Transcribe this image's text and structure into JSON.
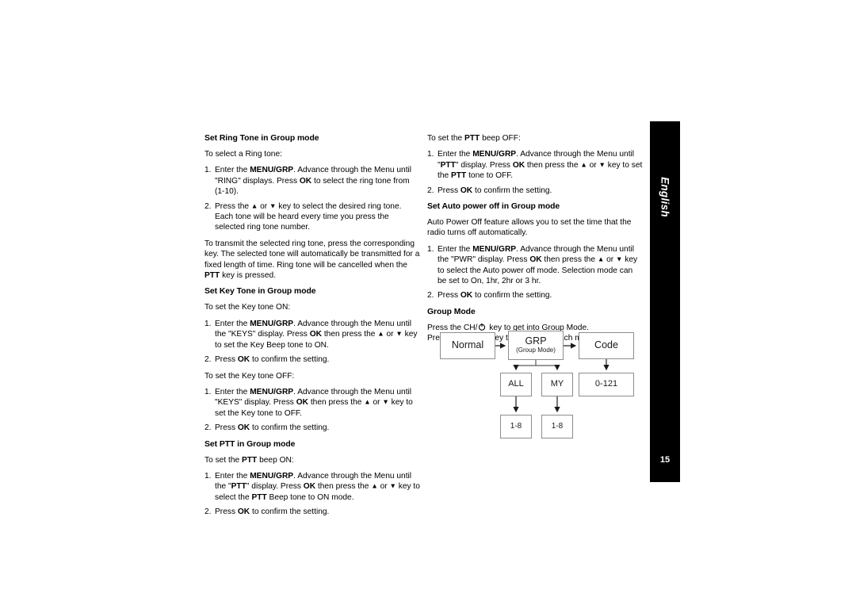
{
  "page": {
    "language_tab": "English",
    "page_number": "15"
  },
  "left_column": {
    "sections": [
      {
        "heading": "Set Ring Tone in Group mode",
        "intro": "To select a Ring tone:",
        "steps": [
          "1. Enter the MENU/GRP. Advance through the Menu until \"RING\" displays. Press OK to select the ring tone from (1-10).",
          "2. Press the ▲ or ▼ key to select the desired ring tone. Each tone will be heard every time you press the selected ring tone number."
        ],
        "outro": "To transmit the selected ring tone, press the corresponding key. The selected tone will automatically be transmitted for a fixed length of time. Ring tone will be cancelled when the PTT key is pressed."
      },
      {
        "heading": "Set Key Tone in Group mode",
        "intro_on": "To set the Key tone ON:",
        "steps_on": [
          "1. Enter the MENU/GRP. Advance through the Menu until the \"KEYS\" display. Press OK then press the ▲ or ▼ key to set the Key Beep tone to ON.",
          "2. Press OK to confirm the setting."
        ],
        "intro_off": "To set the Key tone OFF:",
        "steps_off": [
          "1. Enter the MENU/GRP. Advance through the Menu until \"KEYS\" display. Press OK then press the ▲ or ▼ key to set the Key tone to OFF.",
          "2. Press OK to confirm the setting."
        ]
      },
      {
        "heading": "Set PTT in Group mode",
        "intro": "To set the PTT beep ON:",
        "steps": [
          "1. Enter the MENU/GRP. Advance through the Menu until the \"PTT\" display. Press OK then press the ▲ or ▼ key to select the PTT Beep tone to ON mode.",
          "2. Press OK to confirm the setting."
        ]
      }
    ]
  },
  "right_column": {
    "ptt_off": {
      "intro": "To set the PTT beep OFF:",
      "steps": [
        "1. Enter the MENU/GRP. Advance through the Menu until \"PTT\" display. Press OK then press the ▲ or ▼ key to set the PTT tone to OFF.",
        "2. Press OK to confirm the setting."
      ]
    },
    "auto_power": {
      "heading": "Set Auto power off in Group mode",
      "intro": "Auto Power Off feature allows you to set the time that the radio turns off automatically.",
      "steps": [
        "1. Enter the MENU/GRP. Advance through the Menu until the \"PWR\" display. Press OK then press the ▲ or ▼ key to select the Auto power off mode. Selection mode can be set to On, 1hr, 2hr or 3 hr.",
        "2. Press OK to confirm the setting."
      ]
    },
    "group_mode": {
      "heading": "Group Mode",
      "line1_a": "Press the CH/",
      "line1_b": "key to get into Group Mode.",
      "line2": "Press the ▲ or ▼ key to proceed to each menu."
    }
  },
  "diagram": {
    "boxes": {
      "normal": "Normal",
      "grp": "GRP",
      "grp_sub": "(Group Mode)",
      "code": "Code",
      "all": "ALL",
      "my": "MY",
      "code_range": "0-121",
      "all_range": "1-8",
      "my_range": "1-8"
    }
  },
  "inline": {
    "menu_grp": "MENU/GRP",
    "ok": "OK",
    "ptt": "PTT",
    "up_arrow": "▲",
    "down_arrow": "▼"
  }
}
